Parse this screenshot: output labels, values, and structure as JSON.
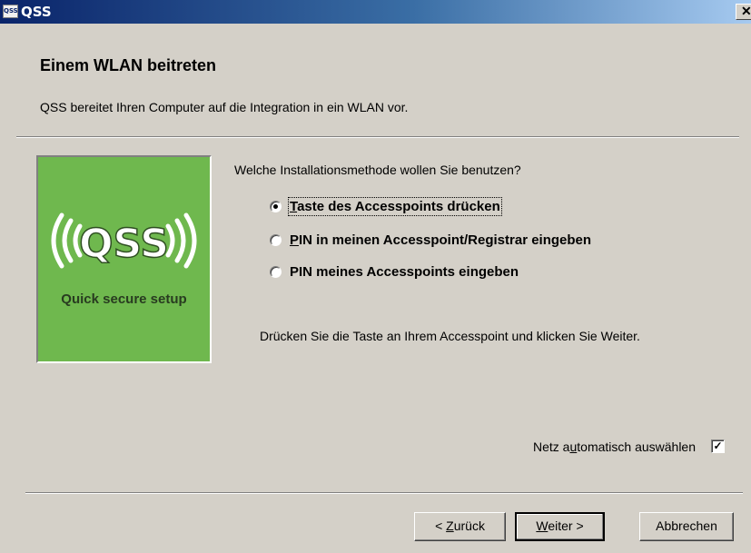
{
  "window": {
    "title": "QSS",
    "icon_label": "QSS",
    "close_glyph": "✕"
  },
  "header": {
    "title": "Einem WLAN beitreten",
    "subtitle": "QSS bereitet Ihren Computer auf die Integration in ein WLAN vor."
  },
  "logo": {
    "text": "QSS",
    "caption": "Quick secure setup",
    "background": "#6fb84e"
  },
  "question": "Welche Installationsmethode wollen Sie benutzen?",
  "options": [
    {
      "mnemonic": "T",
      "rest": "aste des Accesspoints drücken",
      "selected": true
    },
    {
      "mnemonic": "P",
      "rest": "IN in meinen Accesspoint/Registrar eingeben",
      "selected": false
    },
    {
      "mnemonic": "",
      "rest": "PIN meines Accesspoints eingeben",
      "selected": false
    }
  ],
  "hint": "Drücken Sie die Taste an Ihrem Accesspoint und klicken Sie Weiter.",
  "auto_select": {
    "pre": "Netz a",
    "mn": "u",
    "post": "tomatisch auswählen",
    "checked": true,
    "check_glyph": "✓"
  },
  "buttons": {
    "back": {
      "pre": "< ",
      "mn": "Z",
      "post": "urück"
    },
    "next": {
      "pre": "",
      "mn": "W",
      "post": "eiter >"
    },
    "cancel": "Abbrechen"
  }
}
